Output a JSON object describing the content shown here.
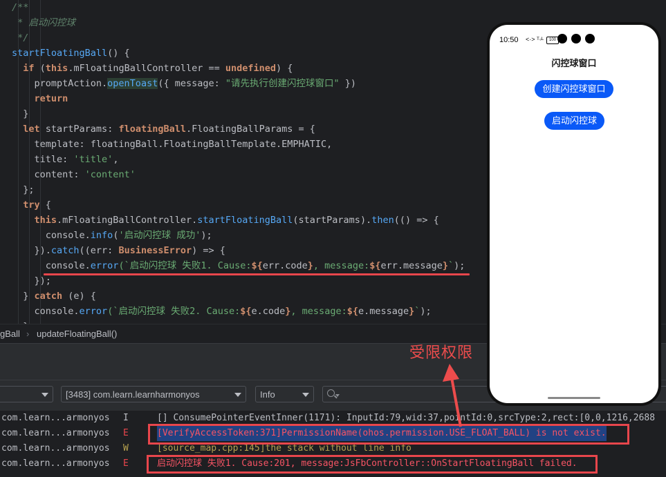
{
  "editor": {
    "lines": [
      [
        {
          "t": "/**",
          "c": "cm"
        }
      ],
      [
        {
          "t": " * 启动闪控球",
          "c": "cm"
        }
      ],
      [
        {
          "t": " */",
          "c": "cm"
        }
      ],
      [
        {
          "t": "startFloatingBall",
          "c": "fn"
        },
        {
          "t": "() {",
          "c": "par"
        }
      ],
      [
        {
          "t": "  ",
          "c": "par"
        },
        {
          "t": "if",
          "c": "kw"
        },
        {
          "t": " (",
          "c": "par"
        },
        {
          "t": "this",
          "c": "kw"
        },
        {
          "t": ".mFloatingBallController == ",
          "c": "par"
        },
        {
          "t": "undefined",
          "c": "kw"
        },
        {
          "t": ") {",
          "c": "par"
        }
      ],
      [
        {
          "t": "    promptAction.",
          "c": "par"
        },
        {
          "t": "openToast",
          "c": "fnhl"
        },
        {
          "t": "({ message: ",
          "c": "par"
        },
        {
          "t": "\"请先执行创建闪控球窗口\"",
          "c": "str"
        },
        {
          "t": " })",
          "c": "par"
        }
      ],
      [
        {
          "t": "    ",
          "c": "par"
        },
        {
          "t": "return",
          "c": "kw"
        }
      ],
      [
        {
          "t": "  }",
          "c": "par"
        }
      ],
      [
        {
          "t": "  ",
          "c": "par"
        },
        {
          "t": "let",
          "c": "kw"
        },
        {
          "t": " startParams: ",
          "c": "par"
        },
        {
          "t": "floatingBall",
          "c": "kw"
        },
        {
          "t": ".FloatingBallParams = {",
          "c": "par"
        }
      ],
      [
        {
          "t": "    template: floatingBall.FloatingBallTemplate.EMPHATIC,",
          "c": "par"
        }
      ],
      [
        {
          "t": "    title: ",
          "c": "par"
        },
        {
          "t": "'title'",
          "c": "str"
        },
        {
          "t": ",",
          "c": "par"
        }
      ],
      [
        {
          "t": "    content: ",
          "c": "par"
        },
        {
          "t": "'content'",
          "c": "str"
        }
      ],
      [
        {
          "t": "  };",
          "c": "par"
        }
      ],
      [
        {
          "t": "  ",
          "c": "par"
        },
        {
          "t": "try",
          "c": "kw"
        },
        {
          "t": " {",
          "c": "par"
        }
      ],
      [
        {
          "t": "    ",
          "c": "par"
        },
        {
          "t": "this",
          "c": "kw"
        },
        {
          "t": ".mFloatingBallController.",
          "c": "par"
        },
        {
          "t": "startFloatingBall",
          "c": "fn"
        },
        {
          "t": "(startParams).",
          "c": "par"
        },
        {
          "t": "then",
          "c": "fn"
        },
        {
          "t": "(() => {",
          "c": "par"
        }
      ],
      [
        {
          "t": "      console.",
          "c": "par"
        },
        {
          "t": "info",
          "c": "fn"
        },
        {
          "t": "(",
          "c": "par"
        },
        {
          "t": "'启动闪控球 成功'",
          "c": "str"
        },
        {
          "t": ");",
          "c": "par"
        }
      ],
      [
        {
          "t": "    }).",
          "c": "par"
        },
        {
          "t": "catch",
          "c": "fn"
        },
        {
          "t": "((err: ",
          "c": "par"
        },
        {
          "t": "BusinessError",
          "c": "kw"
        },
        {
          "t": ") => {",
          "c": "par"
        }
      ],
      [
        {
          "t": "      console.",
          "c": "par"
        },
        {
          "t": "error",
          "c": "fn"
        },
        {
          "t": "(`启动闪控球 失败1. Cause:",
          "c": "str"
        },
        {
          "t": "${",
          "c": "kw"
        },
        {
          "t": "err.code",
          "c": "par"
        },
        {
          "t": "}",
          "c": "kw"
        },
        {
          "t": ", message:",
          "c": "str"
        },
        {
          "t": "${",
          "c": "kw"
        },
        {
          "t": "err.message",
          "c": "par"
        },
        {
          "t": "}",
          "c": "kw"
        },
        {
          "t": "`",
          "c": "str"
        },
        {
          "t": ");",
          "c": "par"
        }
      ],
      [
        {
          "t": "    });",
          "c": "par"
        }
      ],
      [
        {
          "t": "  } ",
          "c": "par"
        },
        {
          "t": "catch",
          "c": "kw"
        },
        {
          "t": " (e) {",
          "c": "par"
        }
      ],
      [
        {
          "t": "    console.",
          "c": "par"
        },
        {
          "t": "error",
          "c": "fn"
        },
        {
          "t": "(`启动闪控球 失败2. Cause:",
          "c": "str"
        },
        {
          "t": "${",
          "c": "kw"
        },
        {
          "t": "e.code",
          "c": "par"
        },
        {
          "t": "}",
          "c": "kw"
        },
        {
          "t": ", message:",
          "c": "str"
        },
        {
          "t": "${",
          "c": "kw"
        },
        {
          "t": "e.message",
          "c": "par"
        },
        {
          "t": "}",
          "c": "kw"
        },
        {
          "t": "`",
          "c": "str"
        },
        {
          "t": ");",
          "c": "par"
        }
      ],
      [
        {
          "t": "  }",
          "c": "par"
        }
      ]
    ]
  },
  "breadcrumb": {
    "items": [
      "gBall",
      "updateFloatingBall()"
    ]
  },
  "log_toolbar": {
    "device_value": "",
    "process_value": "[3483] com.learn.learnharmonyos",
    "level_value": "Info",
    "search_placeholder": ""
  },
  "log_rows": [
    {
      "tag": "com.learn...armonyos",
      "level": "I",
      "message": "[] ConsumePointerEventInner(1171): InputId:79,wid:37,pointId:0,srcType:2,rect:[0,0,1216,2688"
    },
    {
      "tag": "com.learn...armonyos",
      "level": "E",
      "message": "[VerifyAccessToken:371]PermissionName(ohos.permission.USE_FLOAT_BALL) is not exist."
    },
    {
      "tag": "com.learn...armonyos",
      "level": "W",
      "message": "[source_map.cpp:145]the stack without line info"
    },
    {
      "tag": "com.learn...armonyos",
      "level": "E",
      "message": "启动闪控球 失败1. Cause:201, message:JsFbController::OnStartFloatingBall failed."
    }
  ],
  "annotation": {
    "label": "受限权限",
    "color": "#ec4c4c"
  },
  "phone": {
    "time": "10:50",
    "status_icons": "<·> ᵀ◦ᴸ",
    "battery": "100",
    "title": "闪控球窗口",
    "buttons": [
      "创建闪控球窗口",
      "启动闪控球"
    ],
    "accent": "#0a59f7"
  }
}
